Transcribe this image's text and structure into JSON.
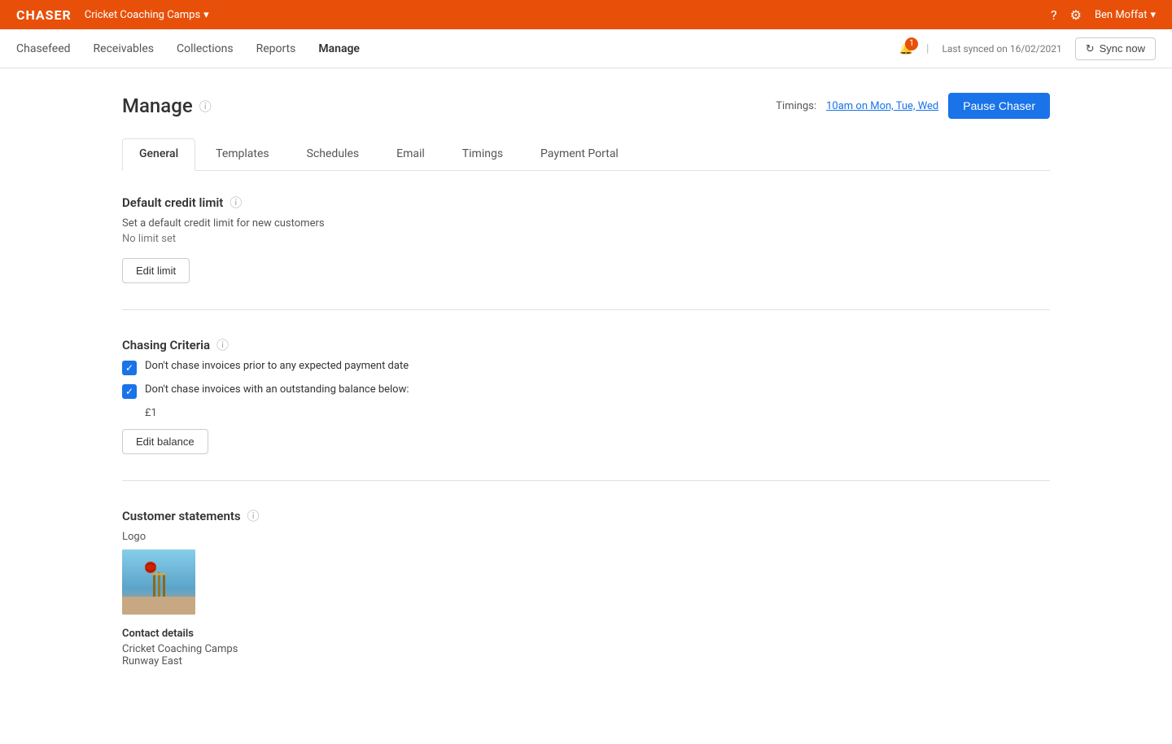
{
  "topbar": {
    "brand": "CHASER",
    "company": "Cricket Coaching Camps",
    "chevron": "▾",
    "help_icon": "?",
    "settings_icon": "⚙",
    "user": "Ben Moffat",
    "user_chevron": "▾"
  },
  "navbar": {
    "links": [
      {
        "label": "Chasefeed",
        "active": false
      },
      {
        "label": "Receivables",
        "active": false
      },
      {
        "label": "Collections",
        "active": false
      },
      {
        "label": "Reports",
        "active": false
      },
      {
        "label": "Manage",
        "active": true
      }
    ],
    "notification_count": "1",
    "sync_status": "Last synced on 16/02/2021",
    "sync_btn_label": "Sync now"
  },
  "page": {
    "title": "Manage",
    "timings_label": "Timings:",
    "timings_value": "10am on Mon, Tue, Wed",
    "pause_btn_label": "Pause Chaser"
  },
  "tabs": [
    {
      "label": "General",
      "active": true
    },
    {
      "label": "Templates",
      "active": false
    },
    {
      "label": "Schedules",
      "active": false
    },
    {
      "label": "Email",
      "active": false
    },
    {
      "label": "Timings",
      "active": false
    },
    {
      "label": "Payment Portal",
      "active": false
    }
  ],
  "sections": {
    "credit_limit": {
      "title": "Default credit limit",
      "desc": "Set a default credit limit for new customers",
      "sub": "No limit set",
      "btn_label": "Edit limit"
    },
    "chasing_criteria": {
      "title": "Chasing Criteria",
      "checkbox1_label": "Don't chase invoices prior to any expected payment date",
      "checkbox2_label": "Don't chase invoices with an outstanding balance below:",
      "balance_value": "£1",
      "btn_label": "Edit balance"
    },
    "customer_statements": {
      "title": "Customer statements",
      "logo_label": "Logo",
      "contact_details_title": "Contact details",
      "contact_line1": "Cricket Coaching Camps",
      "contact_line2": "Runway East"
    }
  }
}
